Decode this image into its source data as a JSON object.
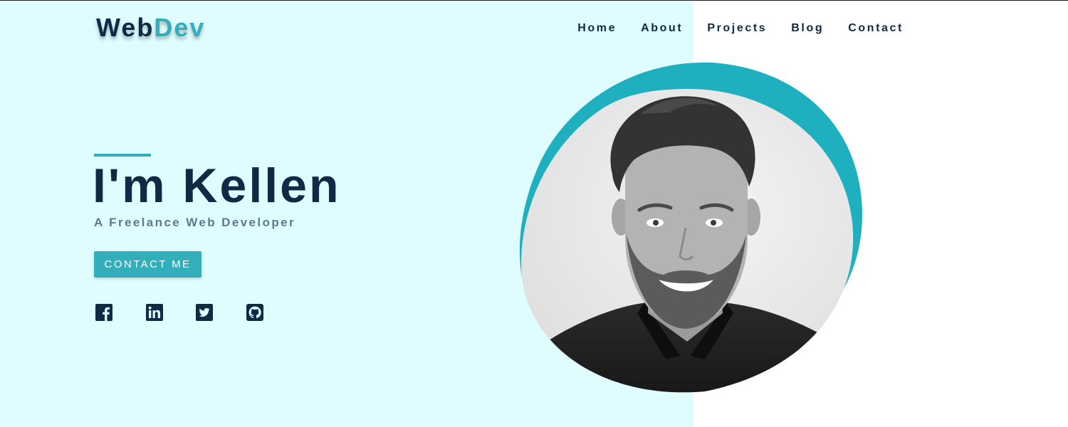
{
  "header": {
    "logo": {
      "part1": "Web",
      "part2": "Dev"
    },
    "nav": [
      {
        "label": "Home"
      },
      {
        "label": "About"
      },
      {
        "label": "Projects"
      },
      {
        "label": "Blog"
      },
      {
        "label": "Contact"
      }
    ]
  },
  "hero": {
    "title": "I'm Kellen",
    "subtitle": "A Freelance Web Developer",
    "cta_label": "CONTACT ME",
    "socials": [
      {
        "icon": "facebook-icon"
      },
      {
        "icon": "linkedin-icon"
      },
      {
        "icon": "twitter-icon"
      },
      {
        "icon": "github-icon"
      }
    ]
  },
  "portrait": {
    "icon": "profile-photo"
  },
  "colors": {
    "accent": "#33aebb",
    "blob": "#1fb0c0",
    "navy": "#0f2a44",
    "hero_bg": "#dffcff",
    "subtitle": "#5d7890"
  }
}
